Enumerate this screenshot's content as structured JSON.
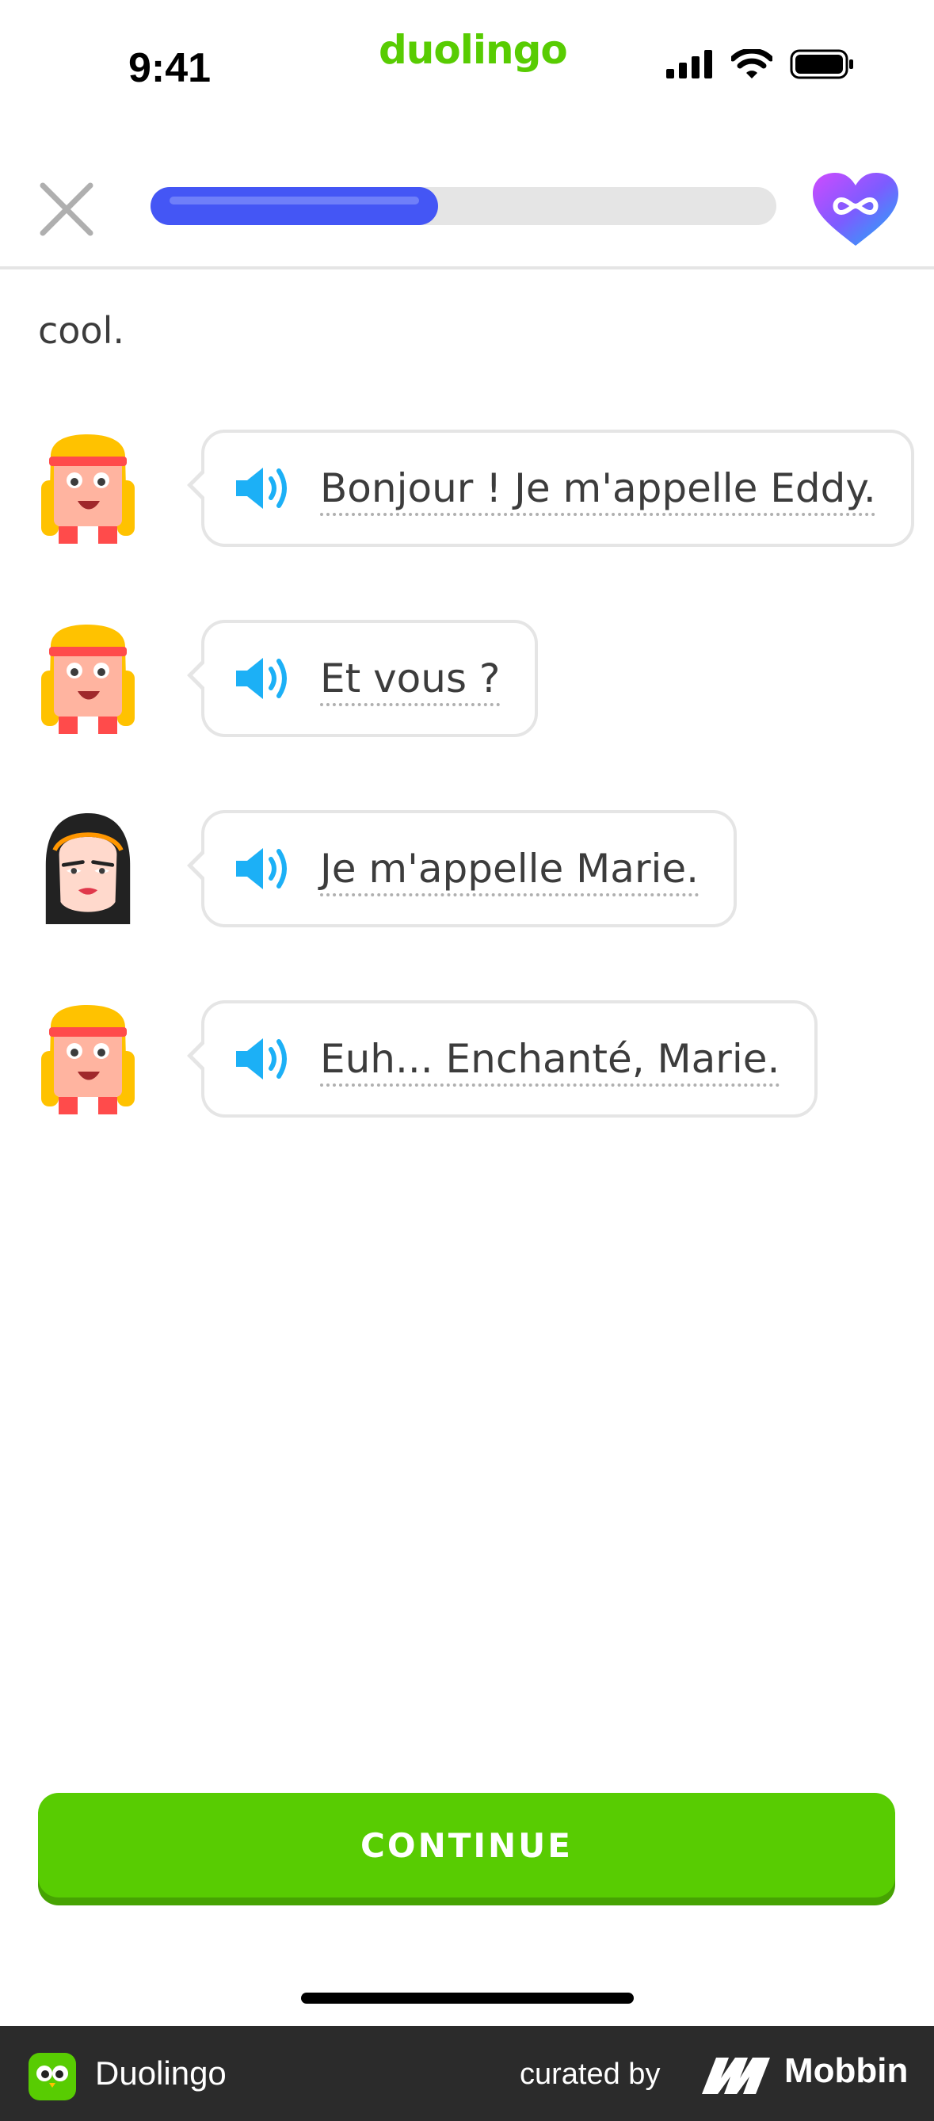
{
  "status_bar": {
    "time": "9:41",
    "brand": "duolingo"
  },
  "lesson": {
    "progress": 0.46,
    "hearts": "infinite"
  },
  "content": {
    "previous_text": "cool.",
    "dialogue": [
      {
        "speaker": "eddy",
        "text": "Bonjour ! Je m'appelle Eddy."
      },
      {
        "speaker": "eddy",
        "text": "Et vous ?"
      },
      {
        "speaker": "marie",
        "text": "Je m'appelle Marie."
      },
      {
        "speaker": "eddy",
        "text": "Euh... Enchanté, Marie."
      }
    ]
  },
  "actions": {
    "continue_label": "CONTINUE"
  },
  "footer": {
    "app_name": "Duolingo",
    "curated_by": "curated by",
    "brand": "Mobbin"
  },
  "colors": {
    "green": "#58cc02",
    "progress_blue": "#4456f5",
    "speaker_blue": "#1cb0f6",
    "border_gray": "#e5e5e5"
  }
}
